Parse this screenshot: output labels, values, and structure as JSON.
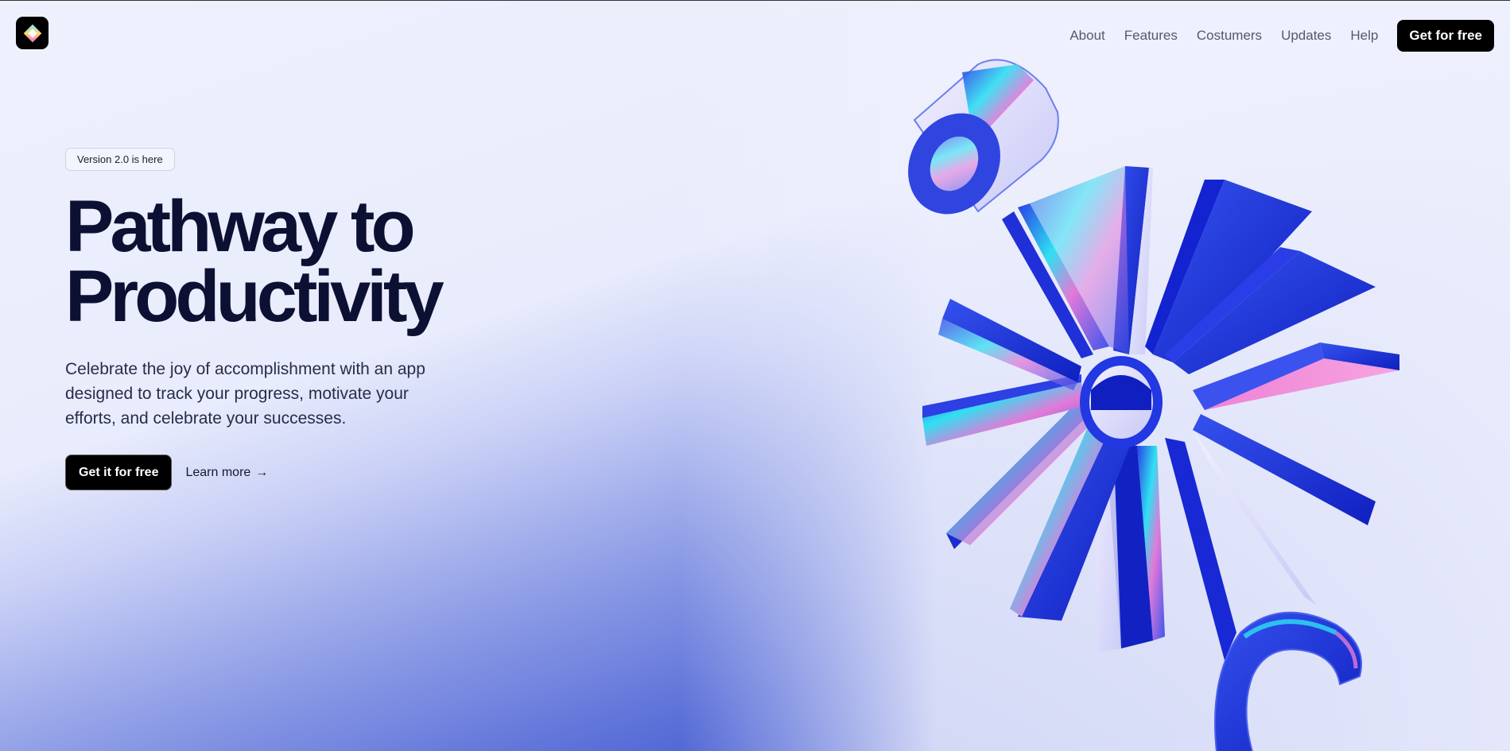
{
  "header": {
    "logo_icon": "diamond-logo-icon",
    "nav": [
      "About",
      "Features",
      "Costumers",
      "Updates",
      "Help"
    ],
    "cta_label": "Get for free"
  },
  "hero": {
    "badge": "Version 2.0 is here",
    "title_line1": "Pathway to",
    "title_line2": "Productivity",
    "description": "Celebrate the joy of accomplishment with an app designed to track your progress, motivate your efforts, and celebrate your successes.",
    "primary_cta": "Get it for free",
    "secondary_cta": "Learn more",
    "secondary_icon": "arrow-right-icon"
  },
  "illustration": {
    "icon": "3d-starburst-illustration",
    "colors": {
      "blue": "#1a2fe0",
      "cyan": "#2fe6f0",
      "pink": "#e27ad8",
      "lavender": "#dcdcfb"
    }
  }
}
